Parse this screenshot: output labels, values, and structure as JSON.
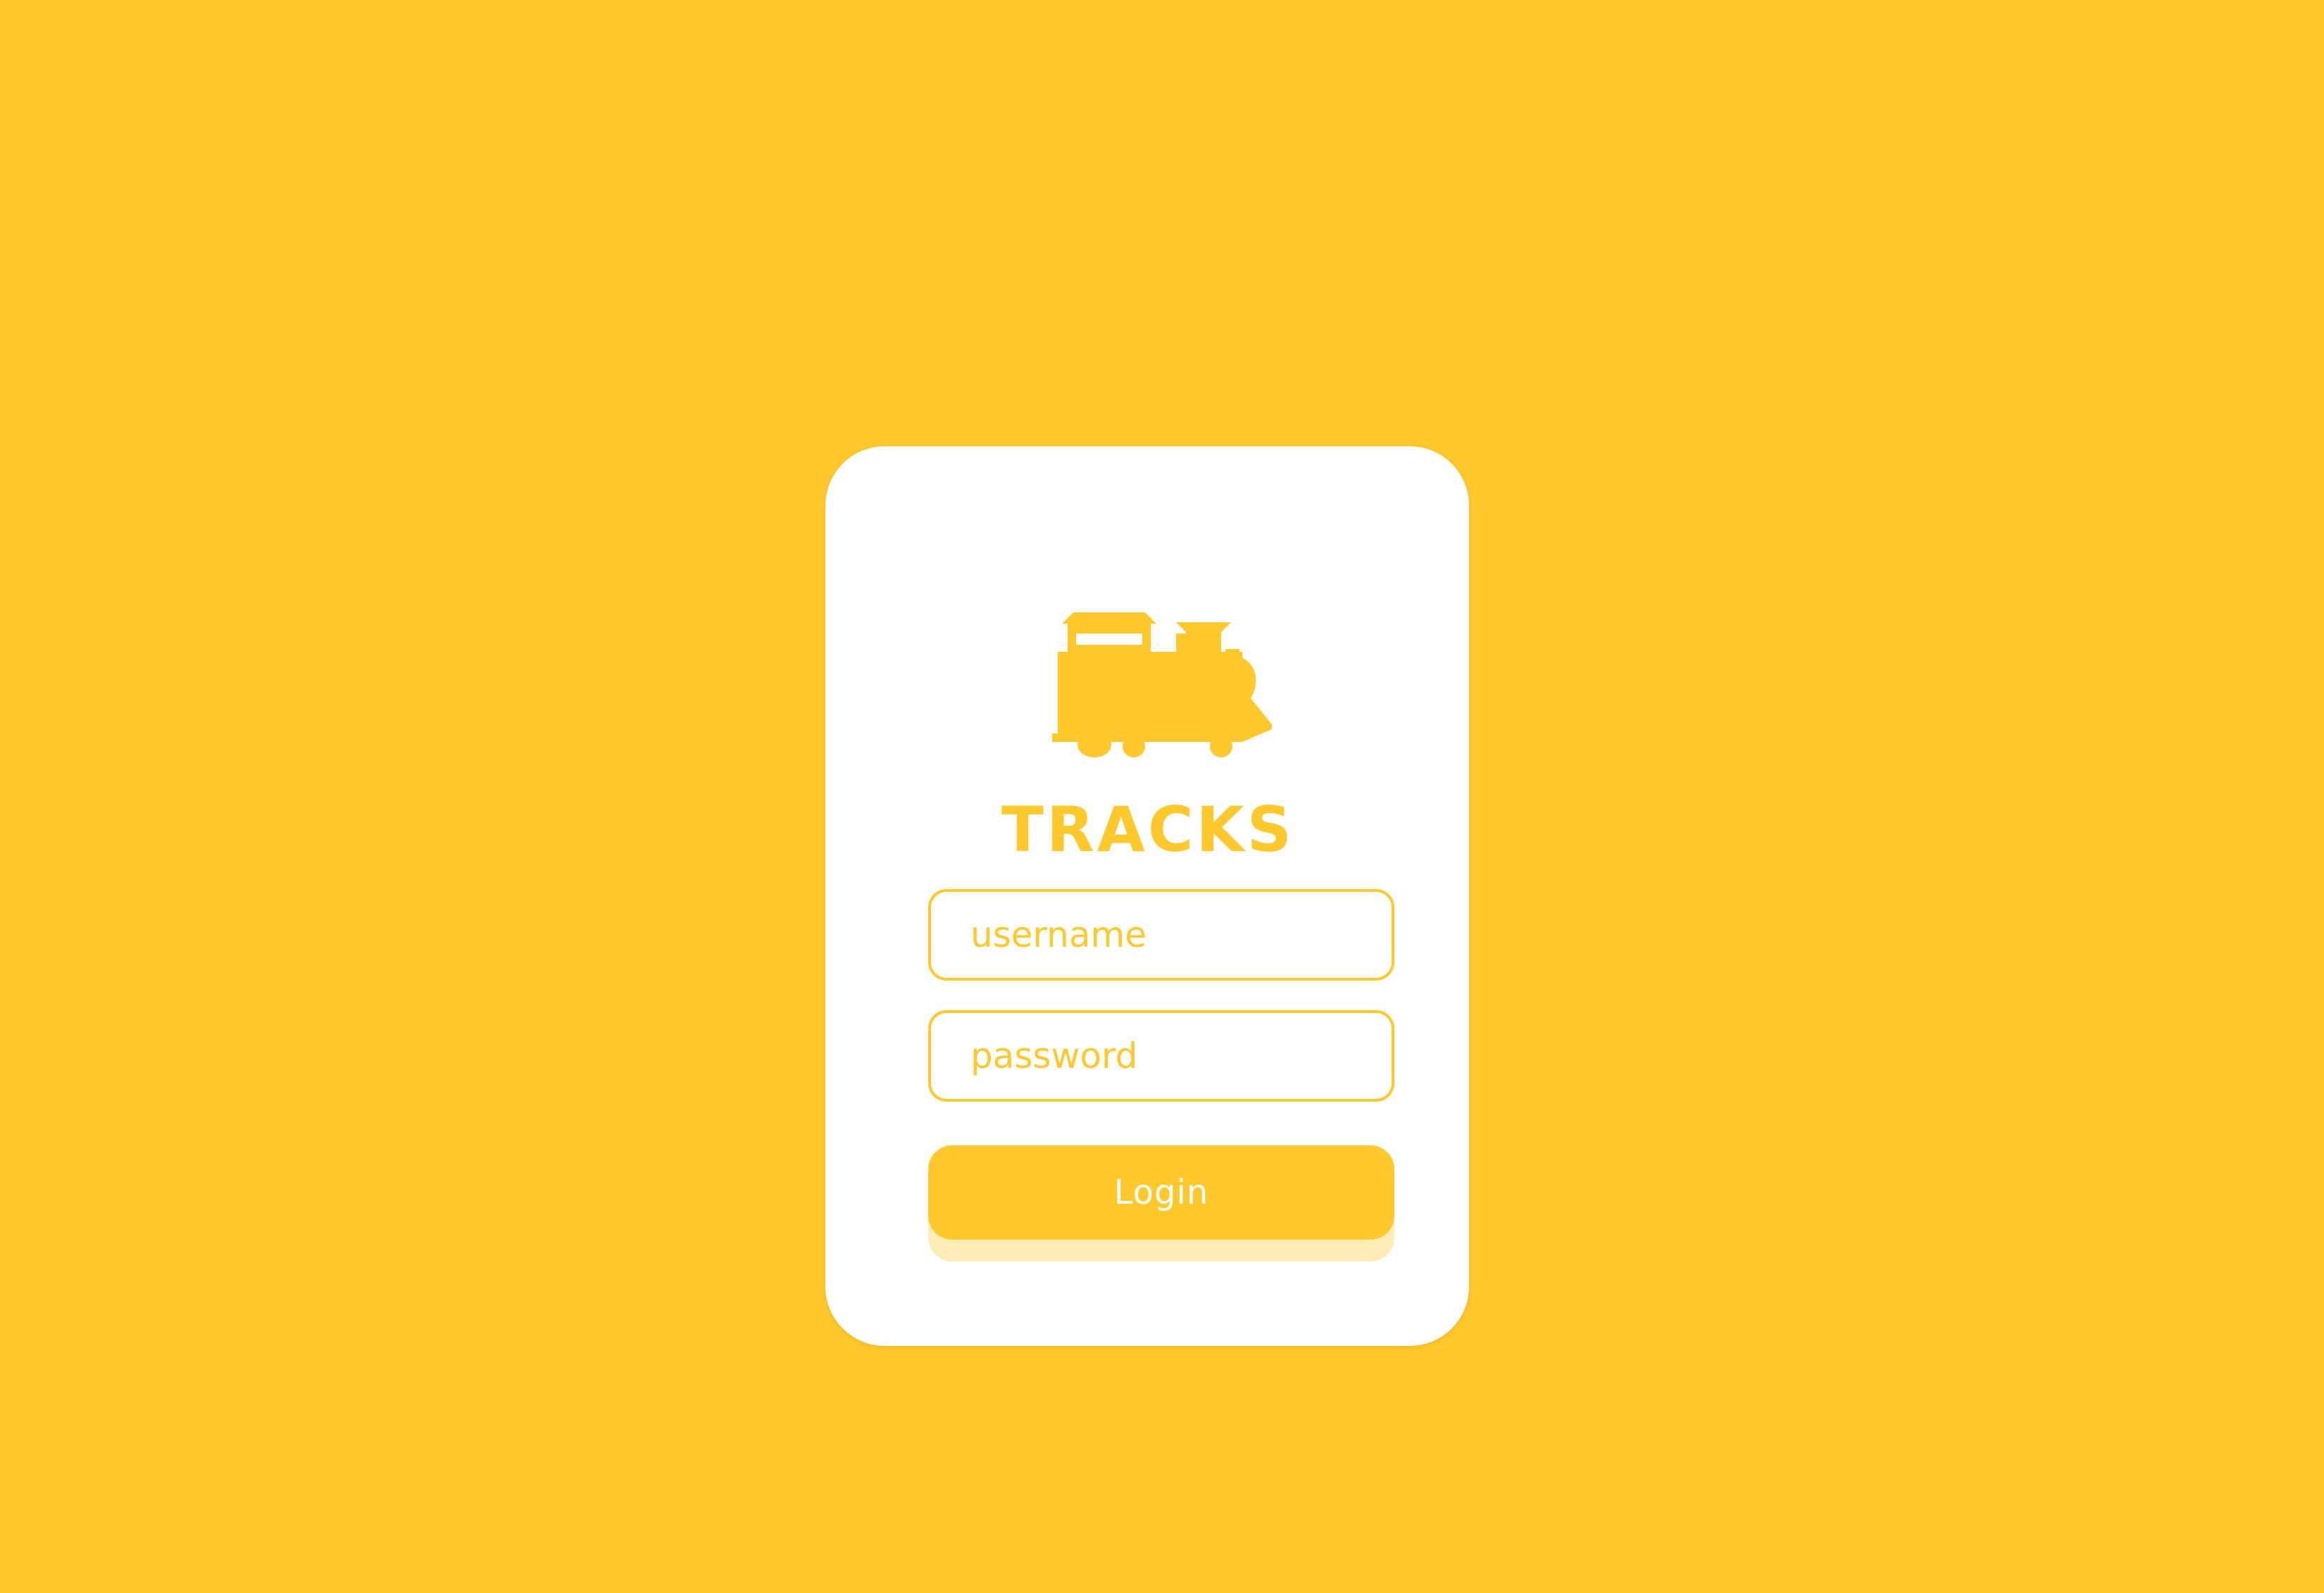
{
  "app": {
    "title": "TRACKS",
    "logo_icon": "train-icon",
    "accent_color": "#FFC82D",
    "background_color": "#FFC82D",
    "card_color": "#FFFFFF"
  },
  "login_form": {
    "username": {
      "value": "",
      "placeholder": "username"
    },
    "password": {
      "value": "",
      "placeholder": "password"
    },
    "submit_label": "Login"
  }
}
